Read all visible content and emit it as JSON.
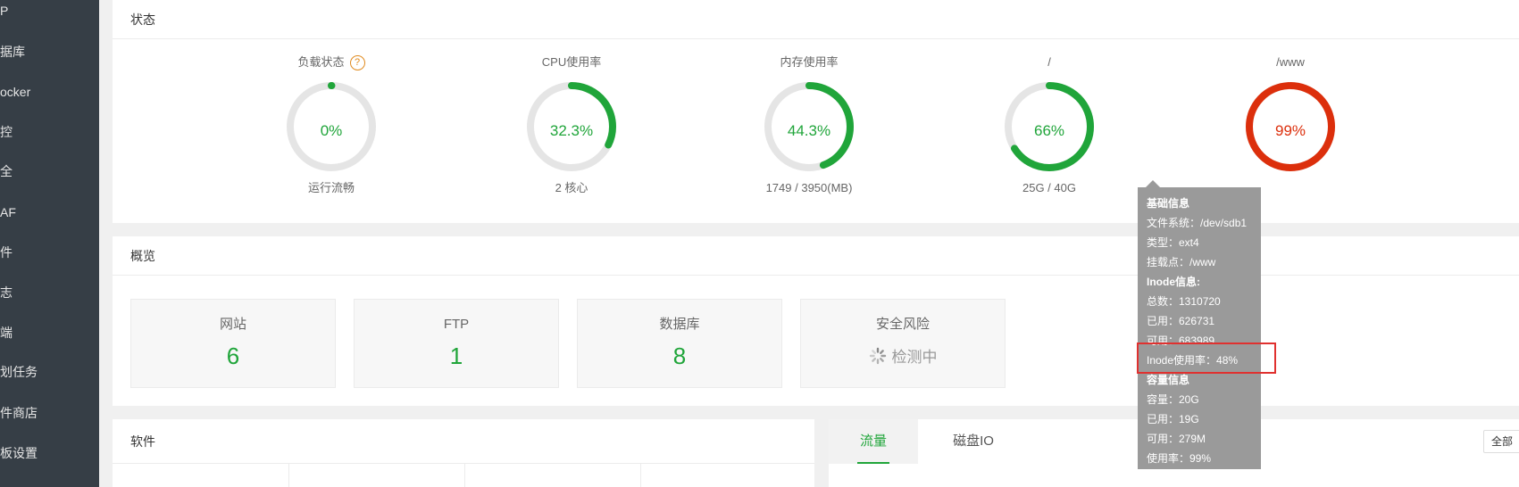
{
  "sidebar": {
    "items": [
      {
        "label": "P"
      },
      {
        "label": "据库"
      },
      {
        "label": "ocker"
      },
      {
        "label": "控"
      },
      {
        "label": "全"
      },
      {
        "label": "AF"
      },
      {
        "label": "件"
      },
      {
        "label": "志"
      },
      {
        "label": "端"
      },
      {
        "label": "划任务"
      },
      {
        "label": "件商店"
      },
      {
        "label": "板设置"
      }
    ]
  },
  "status": {
    "title": "状态",
    "gauges": [
      {
        "title": "负载状态",
        "value": "0%",
        "subtitle": "运行流畅",
        "percent": 0,
        "color": "#20a53a"
      },
      {
        "title": "CPU使用率",
        "value": "32.3%",
        "subtitle": "2 核心",
        "percent": 32.3,
        "color": "#20a53a"
      },
      {
        "title": "内存使用率",
        "value": "44.3%",
        "subtitle": "1749 / 3950(MB)",
        "percent": 44.3,
        "color": "#20a53a"
      },
      {
        "title": "/",
        "value": "66%",
        "subtitle": "25G / 40G",
        "percent": 66,
        "color": "#20a53a"
      },
      {
        "title": "/www",
        "value": "99%",
        "subtitle": "",
        "percent": 99,
        "color": "#dc2f0c"
      }
    ],
    "help_icon": "question-icon"
  },
  "overview": {
    "title": "概览",
    "cards": [
      {
        "label": "网站",
        "value": "6"
      },
      {
        "label": "FTP",
        "value": "1"
      },
      {
        "label": "数据库",
        "value": "8"
      },
      {
        "label": "安全风险",
        "value": "检测中"
      }
    ]
  },
  "software": {
    "title": "软件"
  },
  "traffic": {
    "tabs": [
      {
        "label": "流量"
      },
      {
        "label": "磁盘IO"
      }
    ],
    "select_value": "全部"
  },
  "tooltip": {
    "lines": [
      "基础信息",
      "文件系统：/dev/sdb1",
      "类型：ext4",
      "挂载点：/www",
      "Inode信息:",
      "总数：1310720",
      "已用：626731",
      "可用：683989",
      "Inode使用率：48%",
      "容量信息",
      "容量：20G",
      "已用：19G",
      "可用：279M",
      "使用率：99%"
    ]
  },
  "colors": {
    "accent": "#20a53a",
    "danger": "#dc2f0c",
    "sidebar_bg": "#363e46"
  }
}
